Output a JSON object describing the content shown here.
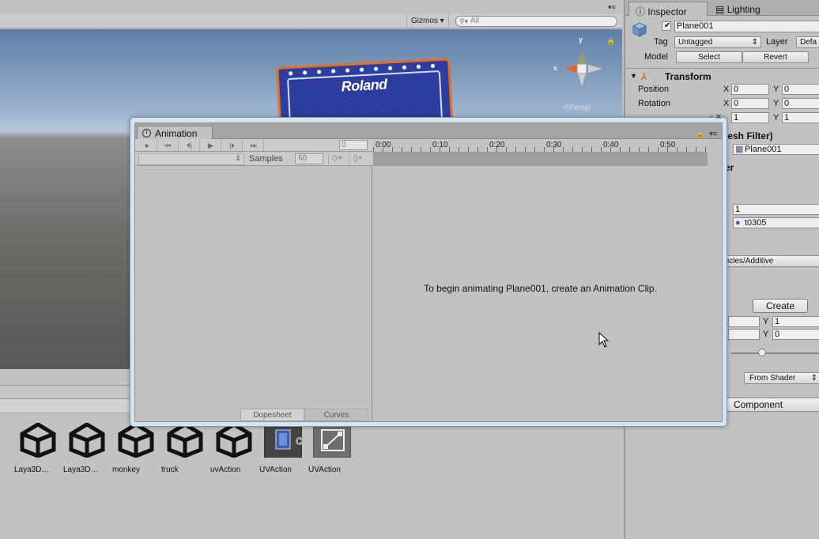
{
  "topbar": {
    "menu_icon": "menu-icon"
  },
  "scene": {
    "gizmos_label": "Gizmos",
    "search_placeholder": "All",
    "sign_logo": "Roland",
    "axis_y": "y",
    "axis_x": "x",
    "persp_label": "Persp"
  },
  "project": {
    "assets": [
      {
        "label": "Laya3D…",
        "kind": "unity"
      },
      {
        "label": "Laya3D…",
        "kind": "unity"
      },
      {
        "label": "monkey",
        "kind": "unity"
      },
      {
        "label": "truck",
        "kind": "unity"
      },
      {
        "label": "uvAction",
        "kind": "unity"
      },
      {
        "label": "UVAction",
        "kind": "anim-clip"
      },
      {
        "label": "UVAction",
        "kind": "controller"
      }
    ]
  },
  "inspector": {
    "tab_inspector": "Inspector",
    "tab_lighting": "Lighting",
    "object_name": "Plane001",
    "tag_label": "Tag",
    "tag_value": "Untagged",
    "layer_label": "Layer",
    "layer_value": "Defa",
    "model_label": "Model",
    "select_btn": "Select",
    "revert_btn": "Revert",
    "transform_title": "Transform",
    "position_label": "Position",
    "rotation_label": "Rotation",
    "position_x": "0",
    "position_y": "0",
    "rotation_x": "0",
    "rotation_y": "0",
    "scale_x": "1",
    "scale_y": "1",
    "x_lbl": "X",
    "y_lbl": "Y",
    "mesh_filter_title": "lesh Filter)",
    "mesh_value": "Plane001",
    "renderer_title": "er",
    "size_value": "1",
    "material_value": "t0305",
    "shader_value": "icles/Additive",
    "tiling_y": "1",
    "offset_y": "0",
    "from_shader": "From Shader",
    "add_component": "Component"
  },
  "animation": {
    "tab_title": "Animation",
    "frame_value": "0",
    "samples_label": "Samples",
    "samples_value": "60",
    "timeline_ticks": [
      "0:00",
      "0:10",
      "0:20",
      "0:30",
      "0:40",
      "0:50"
    ],
    "message": "To begin animating Plane001, create an Animation Clip.",
    "create_button": "Create",
    "dopesheet_tab": "Dopesheet",
    "curves_tab": "Curves"
  }
}
